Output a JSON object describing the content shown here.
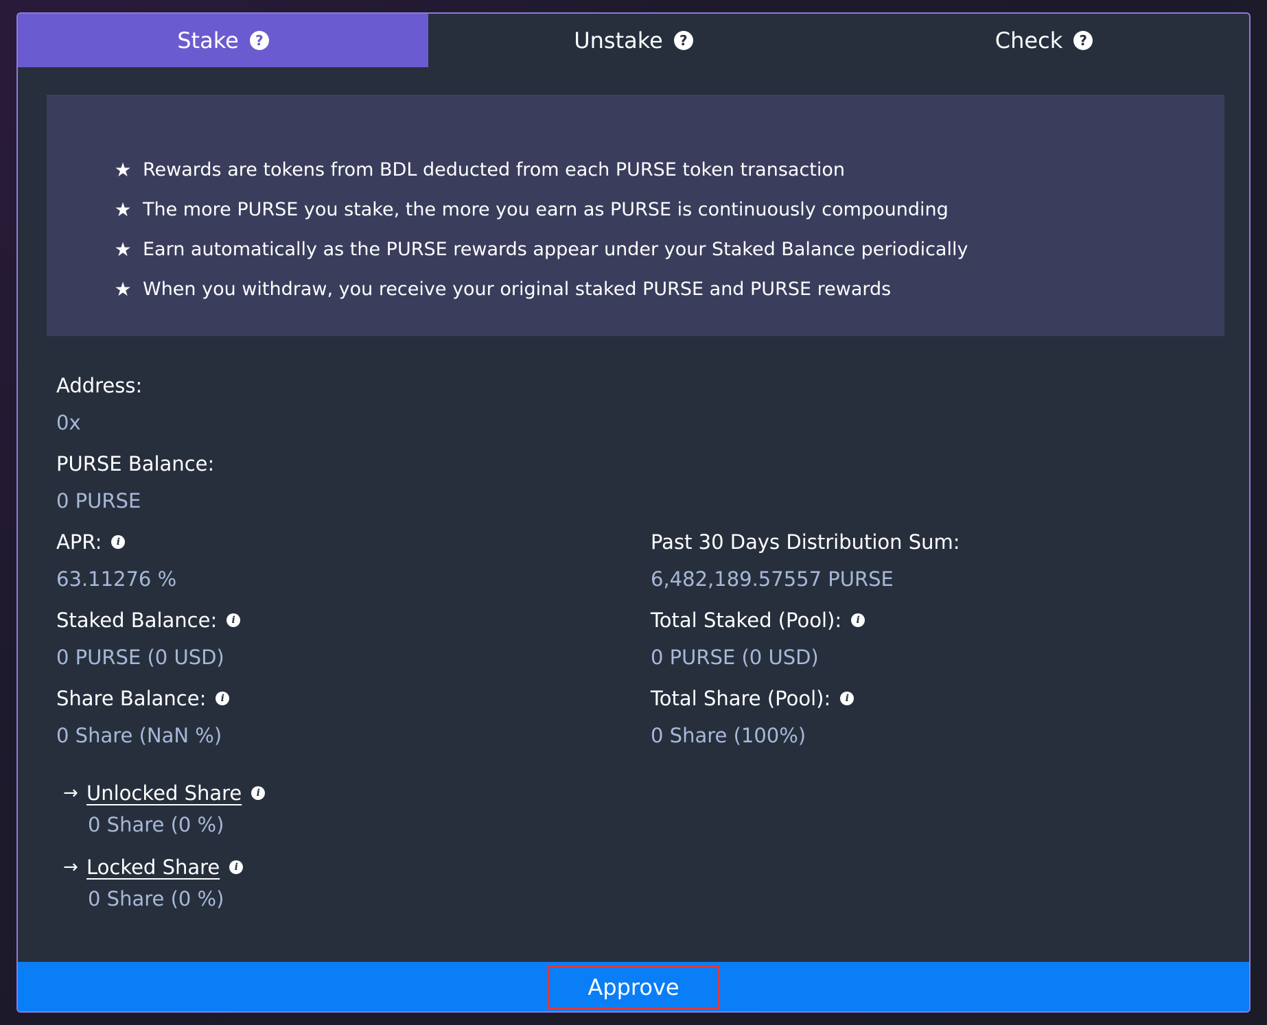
{
  "tabs": [
    {
      "label": "Stake",
      "active": true
    },
    {
      "label": "Unstake",
      "active": false
    },
    {
      "label": "Check",
      "active": false
    }
  ],
  "info": {
    "items": [
      "Rewards are tokens from BDL deducted from each PURSE token transaction",
      "The more PURSE you stake,  the more you earn as PURSE is continuously compounding",
      "Earn automatically as the PURSE rewards appear under your Staked Balance periodically",
      "When you withdraw,  you receive your original staked PURSE and PURSE rewards"
    ]
  },
  "address": {
    "label": "Address:",
    "value": "0x"
  },
  "purse_balance": {
    "label": "PURSE Balance:",
    "value": "0 PURSE"
  },
  "apr": {
    "label": "APR:",
    "value": "63.11276 %"
  },
  "past_30_days": {
    "label": "Past 30 Days Distribution Sum:",
    "value": "6,482,189.57557 PURSE"
  },
  "staked_balance": {
    "label": "Staked Balance:",
    "value": "0 PURSE (0 USD)"
  },
  "total_staked": {
    "label": "Total Staked (Pool):",
    "value": "0 PURSE (0 USD)"
  },
  "share_balance": {
    "label": "Share Balance:",
    "value": "0 Share (NaN %)"
  },
  "total_share": {
    "label": "Total Share (Pool):",
    "value": "0 Share (100%)"
  },
  "unlocked_share": {
    "label": "Unlocked Share",
    "value": "0 Share (0 %)"
  },
  "locked_share": {
    "label": "Locked Share",
    "value": "0 Share (0 %)"
  },
  "approve": {
    "label": "Approve"
  },
  "colors": {
    "tab_active": "#6b5bd0",
    "panel_bg": "#272f3d",
    "info_bg": "#3a3d5c",
    "value_text": "#a7b8d8",
    "approve_bar": "#0a7ef7",
    "highlight_border": "#e53935"
  }
}
